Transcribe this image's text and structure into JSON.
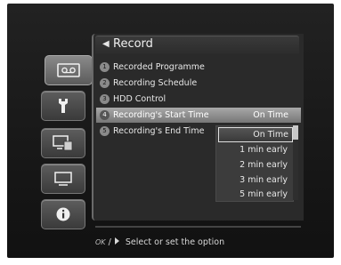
{
  "menu": {
    "title": "Record",
    "items": [
      {
        "number": "1",
        "label": "Recorded Programme",
        "value": ""
      },
      {
        "number": "2",
        "label": "Recording Schedule",
        "value": ""
      },
      {
        "number": "3",
        "label": "HDD Control",
        "value": ""
      },
      {
        "number": "4",
        "label": "Recording's Start Time",
        "value": "On Time"
      },
      {
        "number": "5",
        "label": "Recording's End Time",
        "value": ""
      }
    ],
    "selected_index": 3
  },
  "dropdown": {
    "options": [
      "On Time",
      "1 min early",
      "2 min early",
      "3 min early",
      "5 min early"
    ],
    "selected": "On Time"
  },
  "sidebar": {
    "icons": [
      "tape-icon",
      "tool-icon",
      "tv-icon",
      "monitor-icon",
      "info-icon"
    ],
    "active": "tape-icon"
  },
  "help": {
    "ok_key": "OK",
    "separator": "/",
    "text": "Select or set the option"
  }
}
